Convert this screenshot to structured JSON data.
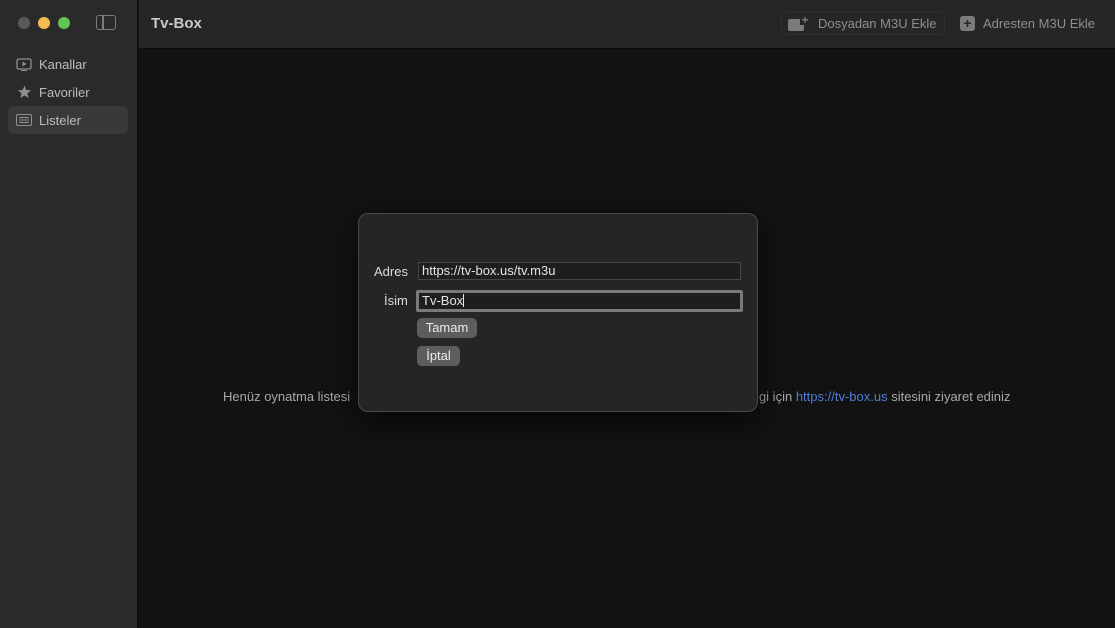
{
  "window": {
    "title": "Tv-Box"
  },
  "sidebar": {
    "items": [
      {
        "label": "Kanallar",
        "icon": "tv-play-icon",
        "active": false
      },
      {
        "label": "Favoriler",
        "icon": "star-icon",
        "active": false
      },
      {
        "label": "Listeler",
        "icon": "list-icon",
        "active": true
      }
    ]
  },
  "toolbar": {
    "file_button": "Dosyadan M3U Ekle",
    "url_button": "Adresten M3U Ekle"
  },
  "main": {
    "empty_prefix": "Henüz oynatma listesi",
    "empty_suffix_a": "ilgi için",
    "empty_link": "https://tv-box.us",
    "empty_suffix_b": "sitesini ziyaret ediniz"
  },
  "dialog": {
    "address_label": "Adres",
    "address_value": "https://tv-box.us/tv.m3u",
    "name_label": "İsim",
    "name_value": "Tv-Box",
    "ok_label": "Tamam",
    "cancel_label": "İptal"
  },
  "colors": {
    "background": "#121212",
    "sidebar": "#2b2a2a",
    "link": "#4f7fd6",
    "close": "#5b5a5a",
    "minimize": "#f5bd4f",
    "maximize": "#61c554"
  }
}
